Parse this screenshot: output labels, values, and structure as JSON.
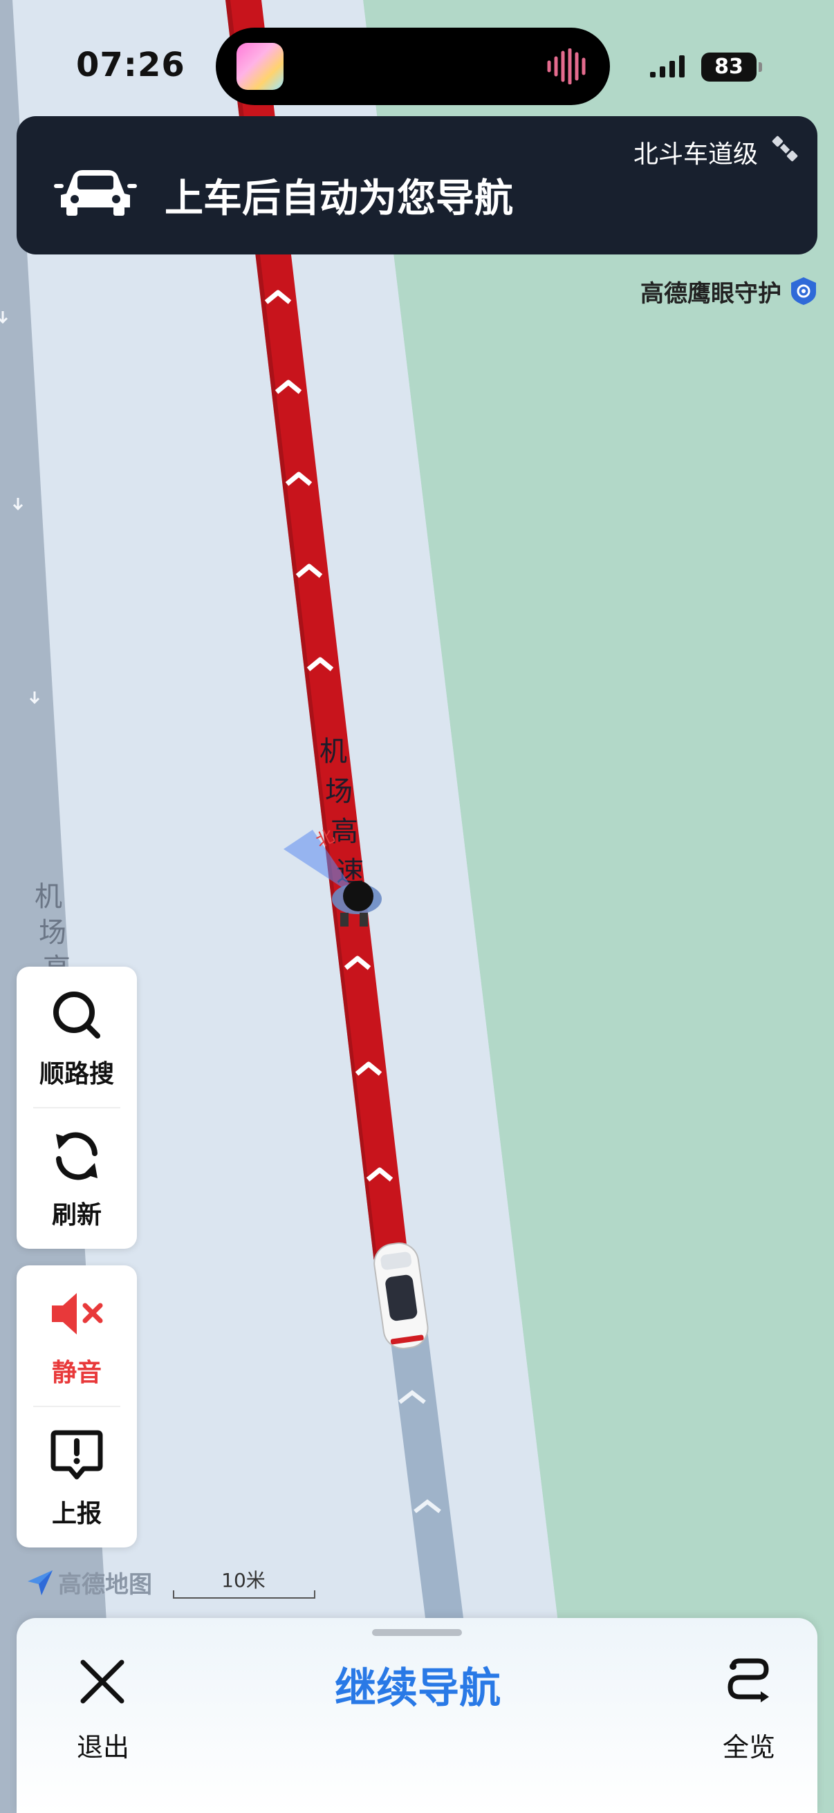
{
  "status_bar": {
    "time": "07:26",
    "battery": "83"
  },
  "nav_banner": {
    "text": "上车后自动为您导航",
    "beidou": "北斗车道级"
  },
  "eagle_eye": {
    "label": "高德鹰眼守护"
  },
  "map": {
    "road_name": "机场高速",
    "side_road_name": "机场高",
    "compass": "北",
    "colors": {
      "route": "#c8141c",
      "grass": "#b2d8c8",
      "road": "#dbe5f0",
      "side_road": "#a8b6c6"
    }
  },
  "tools": {
    "search": {
      "label": "顺路搜",
      "icon": "search-icon"
    },
    "refresh": {
      "label": "刷新",
      "icon": "refresh-icon"
    },
    "mute": {
      "label": "静音",
      "icon": "mute-icon",
      "color": "#e8393a"
    },
    "report": {
      "label": "上报",
      "icon": "report-icon"
    }
  },
  "brand": {
    "logo_text": "高德地图"
  },
  "scale": {
    "label": "10米"
  },
  "bottom": {
    "exit_label": "退出",
    "continue_label": "继续导航",
    "overview_label": "全览"
  }
}
